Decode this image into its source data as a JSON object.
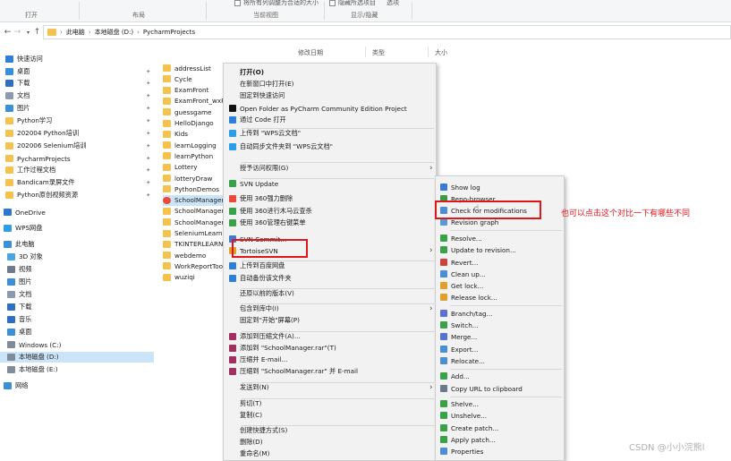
{
  "ribbon": {
    "groups": [
      "打开",
      "布局",
      "当前视图",
      "显示/隐藏"
    ],
    "top_items": [
      "将所有列调整为合适的大小",
      "隐藏所选项目",
      "选项"
    ]
  },
  "address": {
    "path": [
      "此电脑",
      "本地磁盘 (D:)",
      "PycharmProjects"
    ]
  },
  "columns": [
    "修改日期",
    "类型",
    "大小"
  ],
  "sidebar": {
    "items": [
      {
        "label": "快速访问",
        "icon": "star-icon",
        "color": "#2f7fd8",
        "pin": false
      },
      {
        "label": "桌面",
        "icon": "desktop-icon",
        "color": "#3a8fd9",
        "pin": true
      },
      {
        "label": "下载",
        "icon": "download-icon",
        "color": "#2e6fc4",
        "pin": true
      },
      {
        "label": "文档",
        "icon": "document-icon",
        "color": "#8a9bb0",
        "pin": true
      },
      {
        "label": "图片",
        "icon": "picture-icon",
        "color": "#3a8fd9",
        "pin": true
      },
      {
        "label": "Python学习",
        "icon": "folder-icon",
        "color": "#f5c250",
        "pin": true
      },
      {
        "label": "202004 Python培训",
        "icon": "folder-icon",
        "color": "#f5c250",
        "pin": true
      },
      {
        "label": "202006 Selenium培训",
        "icon": "folder-icon",
        "color": "#f5c250",
        "pin": true
      },
      {
        "label": "PycharmProjects",
        "icon": "folder-icon",
        "color": "#f5c250",
        "pin": true
      },
      {
        "label": "工作过程文档",
        "icon": "folder-icon",
        "color": "#f5c250",
        "pin": true
      },
      {
        "label": "Bandicam录屏文件",
        "icon": "folder-icon",
        "color": "#f5c250",
        "pin": true
      },
      {
        "label": "Python原创视频资源",
        "icon": "folder-icon",
        "color": "#f5c250",
        "pin": true
      },
      {
        "label": "OneDrive",
        "icon": "cloud-icon",
        "color": "#2a78d4",
        "pin": false
      },
      {
        "label": "WPS网盘",
        "icon": "cloud-icon",
        "color": "#2a9fe8",
        "pin": false
      },
      {
        "label": "此电脑",
        "icon": "computer-icon",
        "color": "#3a8fd9",
        "pin": false
      },
      {
        "label": "3D 对象",
        "icon": "3d-objects-icon",
        "color": "#49a6e6",
        "pin": false
      },
      {
        "label": "视频",
        "icon": "video-icon",
        "color": "#6d7b8c",
        "pin": false
      },
      {
        "label": "图片",
        "icon": "picture-icon",
        "color": "#3a8fd9",
        "pin": false
      },
      {
        "label": "文档",
        "icon": "document-icon",
        "color": "#8a9bb0",
        "pin": false
      },
      {
        "label": "下载",
        "icon": "download-icon",
        "color": "#2e6fc4",
        "pin": false
      },
      {
        "label": "音乐",
        "icon": "music-icon",
        "color": "#2e6fc4",
        "pin": false
      },
      {
        "label": "桌面",
        "icon": "desktop-icon",
        "color": "#3a8fd9",
        "pin": false
      },
      {
        "label": "Windows (C:)",
        "icon": "drive-icon",
        "color": "#7f8c99",
        "pin": false
      },
      {
        "label": "本地磁盘 (D:)",
        "icon": "drive-icon",
        "color": "#7f8c99",
        "pin": false
      },
      {
        "label": "本地磁盘 (E:)",
        "icon": "drive-icon",
        "color": "#7f8c99",
        "pin": false
      },
      {
        "label": "网络",
        "icon": "network-icon",
        "color": "#3a8fd9",
        "pin": false
      }
    ]
  },
  "files": [
    "addressList",
    "Cycle",
    "ExamFront",
    "ExamFront_wxPy",
    "guessgame",
    "HelloDjango",
    "Kids",
    "learnLogging",
    "learnPython",
    "Lottery",
    "lotteryDraw",
    "PythonDemos",
    "SchoolManager",
    "SchoolManager_",
    "SchoolManager_",
    "SeleniumLearn",
    "TKINTERLEARN",
    "webdemo",
    "WorkReportToo",
    "wuziqi"
  ],
  "menu": {
    "items": [
      {
        "label": "打开(O)",
        "icon": "",
        "bold": true
      },
      {
        "label": "在新窗口中打开(E)",
        "icon": ""
      },
      {
        "label": "固定到快速访问",
        "icon": ""
      },
      {
        "label": "Open Folder as PyCharm Community Edition Project",
        "icon": "pycharm-icon"
      },
      {
        "label": "通过 Code 打开",
        "icon": "vscode-icon"
      },
      {
        "label": "上传到 \"WPS云文档\"",
        "icon": "wps-cloud-icon"
      },
      {
        "label": "自动同步文件夹到 \"WPS云文档\"",
        "icon": "wps-sync-icon"
      },
      {
        "label": "授予访问权限(G)",
        "icon": "",
        "submenu": true
      },
      {
        "label": "SVN Update",
        "icon": "svn-update-icon"
      },
      {
        "label": "使用 360强力删除",
        "icon": "360-delete-icon"
      },
      {
        "label": "使用 360进行木马云查杀",
        "icon": "360-scan-icon"
      },
      {
        "label": "使用 360管理右键菜单",
        "icon": "360-menu-icon"
      },
      {
        "label": "SVN Commit...",
        "icon": "svn-commit-icon"
      },
      {
        "label": "TortoiseSVN",
        "icon": "tortoisesvn-icon",
        "submenu": true
      },
      {
        "label": "上传到百度网盘",
        "icon": "baidu-icon"
      },
      {
        "label": "自动备份该文件夹",
        "icon": "baidu-backup-icon"
      },
      {
        "label": "还原以前的版本(V)",
        "icon": ""
      },
      {
        "label": "包含到库中(I)",
        "icon": "",
        "submenu": true
      },
      {
        "label": "固定到\"开始\"屏幕(P)",
        "icon": ""
      },
      {
        "label": "添加到压缩文件(A)...",
        "icon": "winrar-icon"
      },
      {
        "label": "添加到 \"SchoolManager.rar\"(T)",
        "icon": "winrar-icon"
      },
      {
        "label": "压缩并 E-mail...",
        "icon": "winrar-icon"
      },
      {
        "label": "压缩到 \"SchoolManager.rar\" 并 E-mail",
        "icon": "winrar-icon"
      },
      {
        "label": "发送到(N)",
        "icon": "",
        "submenu": true
      },
      {
        "label": "剪切(T)",
        "icon": ""
      },
      {
        "label": "复制(C)",
        "icon": ""
      },
      {
        "label": "创建快捷方式(S)",
        "icon": ""
      },
      {
        "label": "删除(D)",
        "icon": ""
      },
      {
        "label": "重命名(M)",
        "icon": ""
      }
    ]
  },
  "submenu": {
    "items": [
      {
        "label": "Show log",
        "icon": "show-log-icon",
        "color": "#3a7bd5"
      },
      {
        "label": "Repo-browser",
        "icon": "repo-browser-icon",
        "color": "#3a9a4a"
      },
      {
        "label": "Check for modifications",
        "icon": "check-modifications-icon",
        "color": "#4a8fd6"
      },
      {
        "label": "Revision graph",
        "icon": "revision-graph-icon",
        "color": "#5a9ad8"
      },
      {
        "label": "Resolve...",
        "icon": "resolve-icon",
        "color": "#3aa04a"
      },
      {
        "label": "Update to revision...",
        "icon": "update-revision-icon",
        "color": "#3aa04a"
      },
      {
        "label": "Revert...",
        "icon": "revert-icon",
        "color": "#d04040"
      },
      {
        "label": "Clean up...",
        "icon": "cleanup-icon",
        "color": "#4a8fd6"
      },
      {
        "label": "Get lock...",
        "icon": "lock-icon",
        "color": "#e0a030"
      },
      {
        "label": "Release lock...",
        "icon": "unlock-icon",
        "color": "#e0a030"
      },
      {
        "label": "Branch/tag...",
        "icon": "branch-icon",
        "color": "#5a6fd0"
      },
      {
        "label": "Switch...",
        "icon": "switch-icon",
        "color": "#3aa04a"
      },
      {
        "label": "Merge...",
        "icon": "merge-icon",
        "color": "#5a6fd0"
      },
      {
        "label": "Export...",
        "icon": "export-icon",
        "color": "#4a8fd6"
      },
      {
        "label": "Relocate...",
        "icon": "relocate-icon",
        "color": "#4a8fd6"
      },
      {
        "label": "Add...",
        "icon": "add-icon",
        "color": "#3aa04a"
      },
      {
        "label": "Copy URL to clipboard",
        "icon": "copy-url-icon",
        "color": "#6a7a8a"
      },
      {
        "label": "Shelve...",
        "icon": "shelve-icon",
        "color": "#3aa04a"
      },
      {
        "label": "Unshelve...",
        "icon": "unshelve-icon",
        "color": "#3aa04a"
      },
      {
        "label": "Create patch...",
        "icon": "create-patch-icon",
        "color": "#3aa04a"
      },
      {
        "label": "Apply patch...",
        "icon": "apply-patch-icon",
        "color": "#3aa04a"
      },
      {
        "label": "Properties",
        "icon": "properties-icon",
        "color": "#4a8fd6"
      }
    ]
  },
  "annotation": "也可以点击这个对比一下有哪些不同",
  "watermark": "CSDN @小小浣熊l"
}
